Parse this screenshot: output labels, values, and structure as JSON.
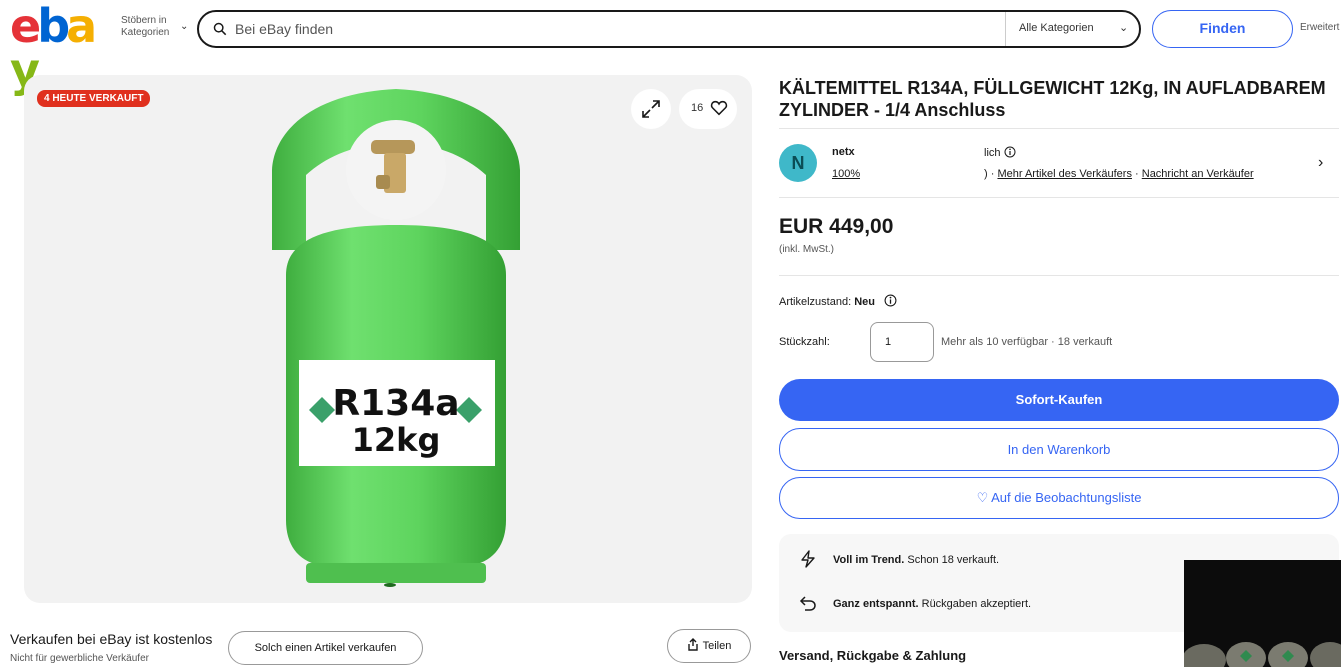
{
  "header": {
    "logo_letters": [
      "e",
      "b",
      "a",
      "y"
    ],
    "logo_colors": [
      "#e53238",
      "#0064d2",
      "#f5af02",
      "#86b817"
    ],
    "browse_line1": "Stöbern in",
    "browse_line2": "Kategorien",
    "search_placeholder": "Bei eBay finden",
    "category_select": "Alle Kategorien",
    "find_button": "Finden",
    "advanced_link": "Erweitert"
  },
  "gallery": {
    "sold_badge": "4 HEUTE VERKAUFT",
    "watch_count": "16",
    "label_line1": "R134a",
    "label_line2": "12kg",
    "cylinder_color": "#5ed45e"
  },
  "listing": {
    "title": "KÄLTEMITTEL R134A, FÜLLGEWICHT 12Kg, IN AUFLADBAREM ZYLINDER - 1/4 Anschluss",
    "seller": {
      "avatar_letter": "N",
      "name_visible": "netx",
      "feedback_visible": "100%",
      "mid_top_text": "lich",
      "links_prefix": ") · ",
      "more_items_link": "Mehr Artikel des Verkäufers",
      "link_separator": " · ",
      "message_link": "Nachricht an Verkäufer"
    },
    "price": "EUR 449,00",
    "price_note": "(inkl. MwSt.)",
    "condition_label": "Artikelzustand: ",
    "condition_value": "Neu",
    "quantity_label": "Stückzahl:",
    "quantity_value": "1",
    "quantity_info": "Mehr als 10 verfügbar · 18 verkauft",
    "buy_now": "Sofort-Kaufen",
    "add_to_cart": "In den Warenkorb",
    "watchlist": "♡ Auf die Beobachtungsliste",
    "trend_bold": "Voll im Trend.",
    "trend_rest": " Schon 18 verkauft.",
    "return_bold": "Ganz entspannt.",
    "return_rest": " Rückgaben akzeptiert.",
    "shipping_heading": "Versand, Rückgabe & Zahlung"
  },
  "footer_left": {
    "sell_title": "Verkaufen bei eBay ist kostenlos",
    "sell_subtitle": "Nicht für gewerbliche Verkäufer",
    "sell_button": "Solch einen Artikel verkaufen",
    "share_button": "Teilen"
  },
  "colors": {
    "accent": "#3665f3",
    "badge_red": "#e0301e"
  }
}
